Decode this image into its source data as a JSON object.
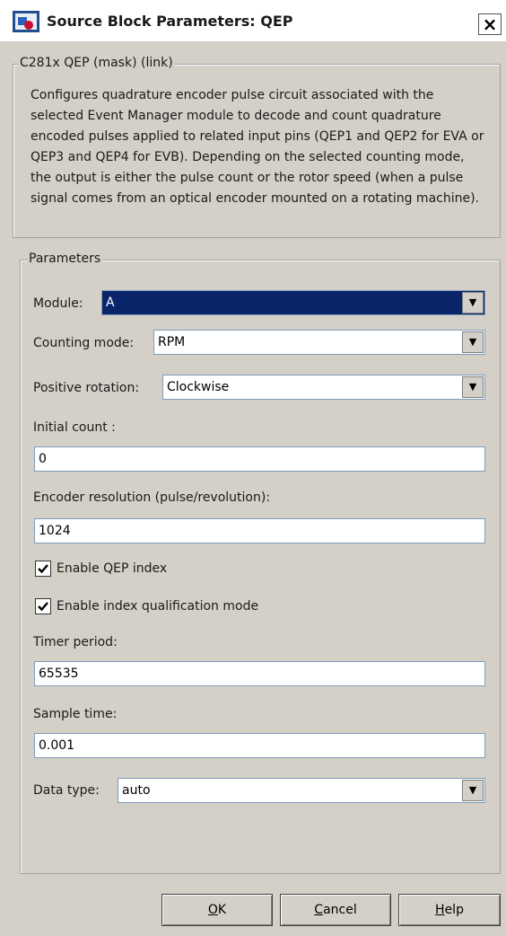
{
  "window": {
    "title": "Source Block Parameters: QEP",
    "close_label": "×"
  },
  "mask": {
    "group_label": "C281x QEP (mask) (link)",
    "description": "Configures quadrature encoder pulse circuit associated with the selected Event Manager module to decode and count quadrature encoded pulses applied to related input pins (QEP1 and QEP2 for EVA or QEP3 and QEP4 for EVB). Depending on the selected counting mode, the output is either the pulse count or the rotor speed (when a pulse signal comes from an optical encoder mounted on a rotating machine)."
  },
  "params": {
    "group_label": "Parameters",
    "module": {
      "label": "Module:",
      "value": "A"
    },
    "counting_mode": {
      "label": "Counting mode:",
      "value": "RPM"
    },
    "positive_rotation": {
      "label": "Positive rotation:",
      "value": "Clockwise"
    },
    "initial_count": {
      "label": "Initial count :",
      "value": "0"
    },
    "encoder_resolution": {
      "label": "Encoder resolution (pulse/revolution):",
      "value": "1024"
    },
    "enable_qep_index": {
      "label": "Enable QEP index",
      "checked": true
    },
    "enable_index_qualification": {
      "label": "Enable index qualification mode",
      "checked": true
    },
    "timer_period": {
      "label": "Timer period:",
      "value": "65535"
    },
    "sample_time": {
      "label": "Sample time:",
      "value": "0.001"
    },
    "data_type": {
      "label": "Data type:",
      "value": "auto"
    }
  },
  "buttons": {
    "ok": {
      "mnemonic": "O",
      "rest": "K"
    },
    "cancel": {
      "mnemonic": "C",
      "rest": "ancel"
    },
    "help": {
      "mnemonic": "H",
      "rest": "elp"
    }
  }
}
